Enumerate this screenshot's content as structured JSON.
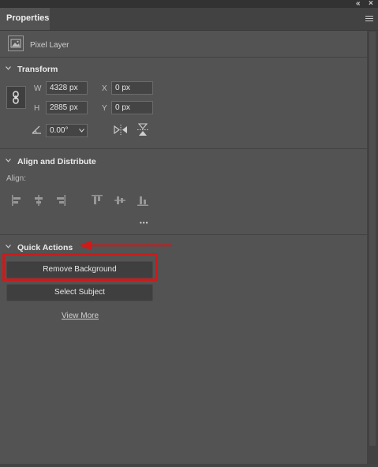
{
  "panel": {
    "tab_label": "Properties",
    "collapse_glyph": "«",
    "close_glyph": "×"
  },
  "layer": {
    "label": "Pixel Layer",
    "icon": "image-icon"
  },
  "transform": {
    "title": "Transform",
    "w_label": "W",
    "w_value": "4328 px",
    "h_label": "H",
    "h_value": "2885 px",
    "x_label": "X",
    "x_value": "0 px",
    "y_label": "Y",
    "y_value": "0 px",
    "angle_value": "0.00°",
    "link_icon": "link-icon",
    "flip_h_icon": "flip-horizontal-icon",
    "flip_v_icon": "flip-vertical-icon"
  },
  "align": {
    "title": "Align and Distribute",
    "align_label": "Align:",
    "more_glyph": "•••"
  },
  "quick_actions": {
    "title": "Quick Actions",
    "remove_bg": "Remove Background",
    "select_subject": "Select Subject",
    "view_more": "View More"
  },
  "colors": {
    "annotation_red": "#d01919",
    "panel_bg": "#535353"
  }
}
